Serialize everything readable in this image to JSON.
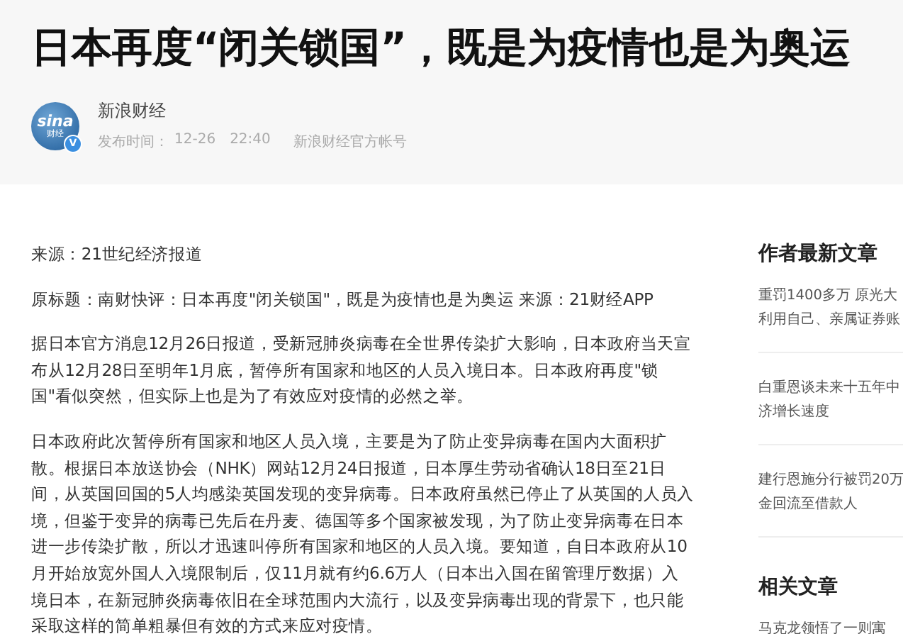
{
  "article": {
    "title": "日本再度“闭关锁国”，既是为疫情也是为奥运",
    "author": {
      "avatar_logo": "sina",
      "avatar_sub": "财经",
      "verified_badge": "V",
      "name": "新浪财经",
      "published_label": "发布时间：",
      "date": "12-26",
      "time": "22:40",
      "account": "新浪财经官方帐号"
    },
    "paragraphs": [
      "来源：21世纪经济报道",
      "原标题：南财快评：日本再度\"闭关锁国\"，既是为疫情也是为奥运 来源：21财经APP",
      "据日本官方消息12月26日报道，受新冠肺炎病毒在全世界传染扩大影响，日本政府当天宣布从12月28日至明年1月底，暂停所有国家和地区的人员入境日本。日本政府再度\"锁国\"看似突然，但实际上也是为了有效应对疫情的必然之举。",
      "日本政府此次暂停所有国家和地区人员入境，主要是为了防止变异病毒在国内大面积扩散。根据日本放送协会（NHK）网站12月24日报道，日本厚生劳动省确认18日至21日间，从英国回国的5人均感染英国发现的变异病毒。日本政府虽然已停止了从英国的人员入境，但鉴于变异的病毒已先后在丹麦、德国等多个国家被发现，为了防止变异病毒在日本进一步传染扩散，所以才迅速叫停所有国家和地区的人员入境。要知道，自日本政府从10月开始放宽外国人入境限制后，仅11月就有约6.6万人（日本出入国在留管理厅数据）入境日本，在新冠肺炎病毒依旧在全球范围内大流行，以及变异病毒出现的背景下，也只能采取这样的简单粗暴但有效的方式来应对疫情。"
    ]
  },
  "sidebar": {
    "author_latest": {
      "heading": "作者最新文章",
      "items": [
        {
          "lines": [
            "重罚1400多万 原光大",
            "利用自己、亲属证券账"
          ]
        },
        {
          "lines": [
            "白重恩谈未来十五年中",
            "济增长速度"
          ]
        },
        {
          "lines": [
            "建行恩施分行被罚20万",
            "金回流至借款人"
          ]
        }
      ]
    },
    "related": {
      "heading": "相关文章",
      "items": [
        {
          "lines": [
            "马克龙领悟了一则寓"
          ]
        }
      ]
    }
  }
}
